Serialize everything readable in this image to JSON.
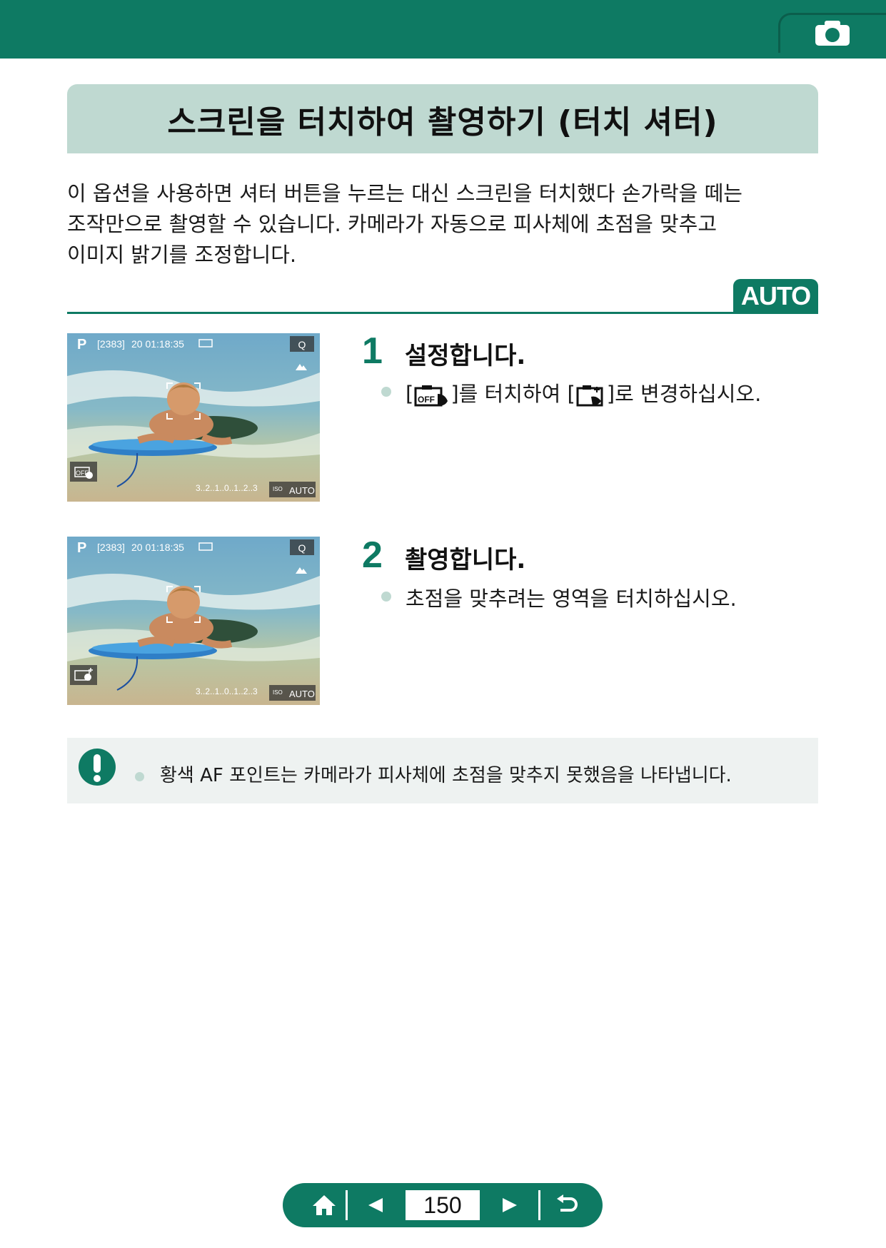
{
  "header": {
    "section_icon": "camera-icon",
    "color": "#0e7a63"
  },
  "title": "스크린을 터치하여 촬영하기 (터치 셔터)",
  "intro": [
    "이 옵션을 사용하면 셔터 버튼을 누르는 대신 스크린을 터치했다 손가락을 떼는",
    "조작만으로 촬영할 수 있습니다. 카메라가 자동으로 피사체에 초점을 맞추고",
    "이미지 밝기를 조정합니다."
  ],
  "mode_badge": "AUTO",
  "camera_screen": {
    "mode": "P",
    "shots": "[2383]",
    "time": "20 01:18:35",
    "quality": "Q",
    "exposure_scale": "3..2..1..0..1..2..3",
    "iso": "ISO",
    "iso_value": "AUTO"
  },
  "steps": [
    {
      "number": "1",
      "title": "설정합니다.",
      "bullet_prefix": "[",
      "bullet_icon_from": "touch-shutter-off-icon",
      "bullet_mid": "]를 터치하여 [",
      "bullet_icon_to": "touch-shutter-on-icon",
      "bullet_suffix": "]로 변경하십시오.",
      "touch_icon": "touch-shutter-off-icon"
    },
    {
      "number": "2",
      "title": "촬영합니다.",
      "bullet": "초점을 맞추려는 영역을 터치하십시오.",
      "touch_icon": "touch-shutter-on-icon"
    }
  ],
  "caution": {
    "icon": "caution-icon",
    "text": "황색 AF 포인트는 카메라가 피사체에 초점을 맞추지 못했음을 나타냅니다."
  },
  "nav": {
    "home_icon": "home-icon",
    "prev_icon": "prev-page-icon",
    "page": "150",
    "next_icon": "next-page-icon",
    "back_icon": "return-icon"
  }
}
